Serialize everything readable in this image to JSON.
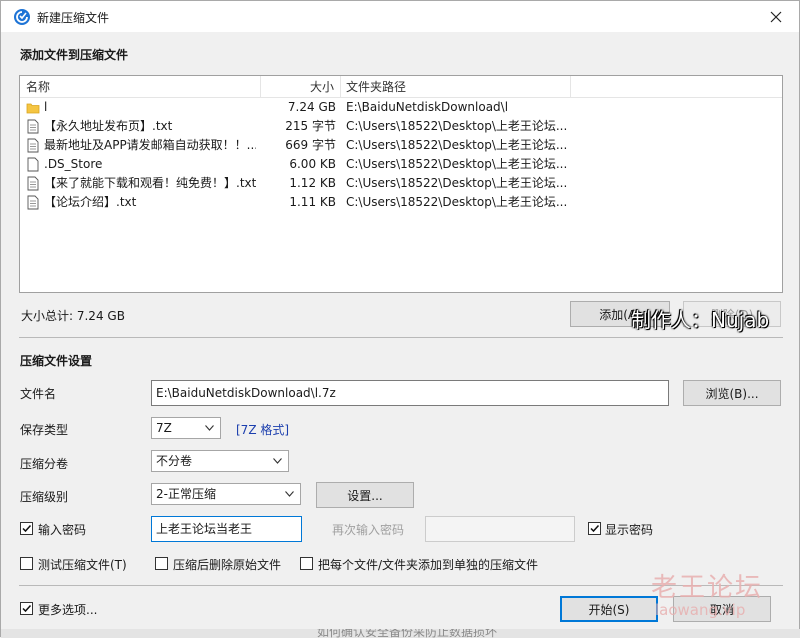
{
  "window": {
    "title": "新建压缩文件",
    "app_icon": "archive-app-icon",
    "close_icon": "close-icon"
  },
  "files_section": {
    "title": "添加文件到压缩文件"
  },
  "list": {
    "columns": [
      "名称",
      "大小",
      "文件夹路径"
    ],
    "rows": [
      {
        "icon": "folder-icon",
        "name": "l",
        "size": "7.24 GB",
        "path": "E:\\BaiduNetdiskDownload\\l"
      },
      {
        "icon": "document-icon",
        "name": "【永久地址发布页】.txt",
        "size": "215 字节",
        "path": "C:\\Users\\18522\\Desktop\\上老王论坛..."
      },
      {
        "icon": "document-icon",
        "name": "最新地址及APP请发邮箱自动获取！！...",
        "size": "669 字节",
        "path": "C:\\Users\\18522\\Desktop\\上老王论坛..."
      },
      {
        "icon": "blank-file-icon",
        "name": ".DS_Store",
        "size": "6.00 KB",
        "path": "C:\\Users\\18522\\Desktop\\上老王论坛..."
      },
      {
        "icon": "document-icon",
        "name": "【来了就能下载和观看！纯免费！】.txt",
        "size": "1.12 KB",
        "path": "C:\\Users\\18522\\Desktop\\上老王论坛..."
      },
      {
        "icon": "document-icon",
        "name": "【论坛介绍】.txt",
        "size": "1.11 KB",
        "path": "C:\\Users\\18522\\Desktop\\上老王论坛..."
      }
    ]
  },
  "total": "大小总计: 7.24 GB",
  "buttons": {
    "add": "添加(A)",
    "delete": "删除(D)",
    "browse": "浏览(B)...",
    "settings": "设置...",
    "start": "开始(S)",
    "cancel": "取消"
  },
  "settings": {
    "title": "压缩文件设置",
    "filename_label": "文件名",
    "filename_value": "E:\\BaiduNetdiskDownload\\l.7z",
    "type_label": "保存类型",
    "type_value": "7Z",
    "type_link": "[7Z 格式]",
    "split_label": "压缩分卷",
    "split_value": "不分卷",
    "level_label": "压缩级别",
    "level_value": "2-正常压缩",
    "password_label": "输入密码",
    "password_checked": true,
    "password_value": "上老王论坛当老王",
    "reenter_label": "再次输入密码",
    "show_password_label": "显示密码",
    "show_password_checked": true,
    "test_label": "测试压缩文件(T)",
    "test_checked": false,
    "delete_after_label": "压缩后删除原始文件",
    "delete_after_checked": false,
    "separate_label": "把每个文件/文件夹添加到单独的压缩文件",
    "separate_checked": false,
    "more_label": "更多选项...",
    "more_checked": true
  },
  "overlay": {
    "credit": "制作人：Nujab",
    "logo_text": "老王论坛",
    "logo_url": "laowang.vip",
    "bottom_text": "如何确认安全备份采防止数据损坏"
  }
}
